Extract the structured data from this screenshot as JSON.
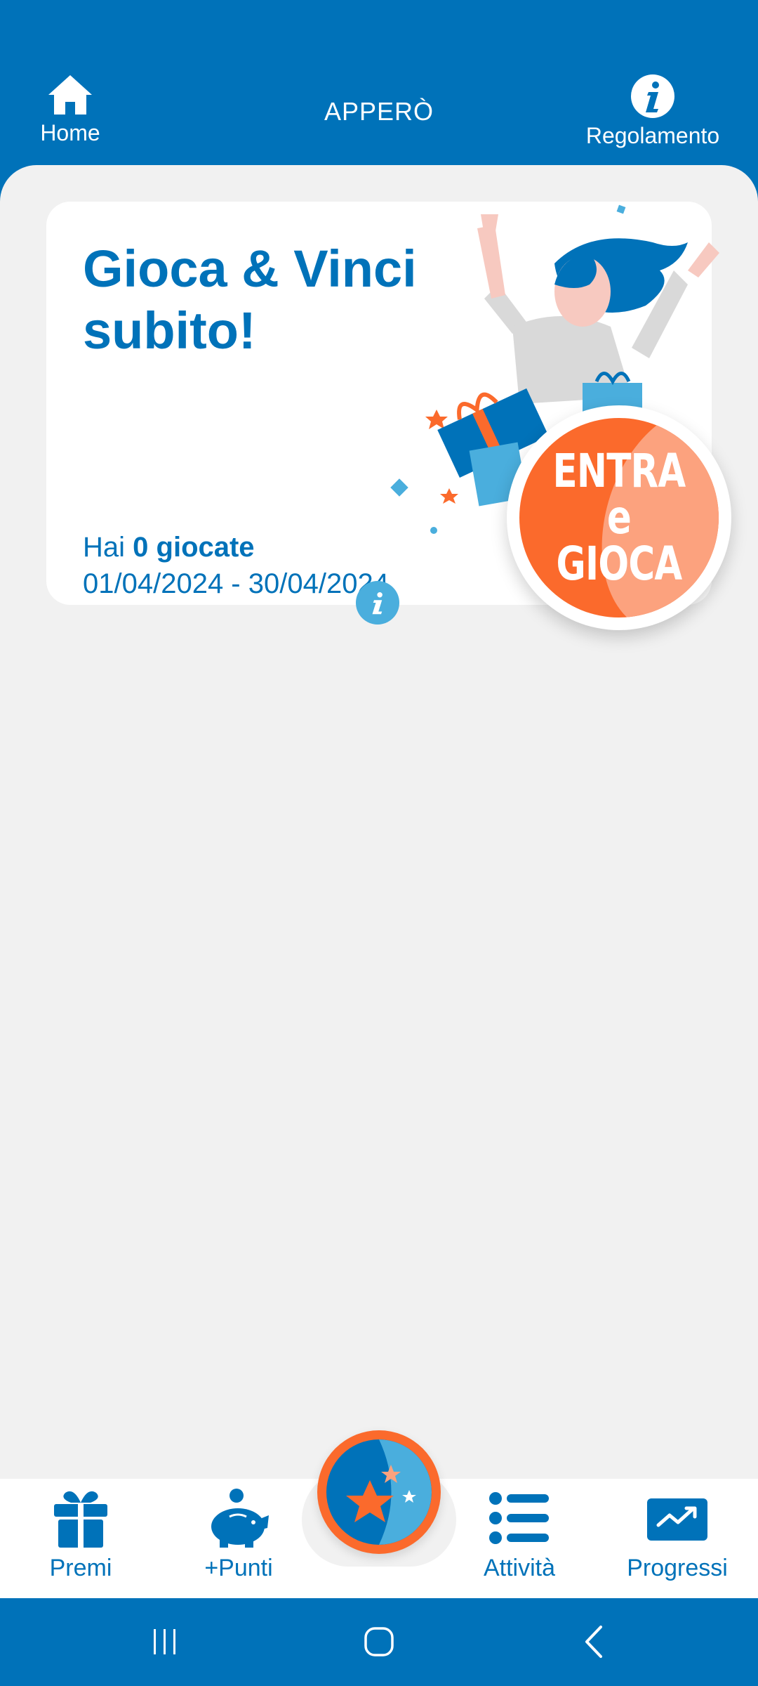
{
  "header": {
    "title": "APPERÒ",
    "home_label": "Home",
    "rules_label": "Regolamento",
    "home_icon": "home-icon",
    "rules_icon": "info-icon"
  },
  "card": {
    "title": "Gioca & Vinci subito!",
    "plays_prefix": "Hai",
    "plays_count": "0 giocate",
    "dates": "01/04/2024 - 30/04/2024",
    "play_button_line1": "ENTRA e",
    "play_button_line2": "GIOCA",
    "info_icon": "info-icon"
  },
  "bottom_nav": {
    "items": [
      {
        "label": "Premi",
        "icon": "gift-icon"
      },
      {
        "label": "+Punti",
        "icon": "piggy-bank-icon"
      },
      {
        "label": "Attività",
        "icon": "list-icon"
      },
      {
        "label": "Progressi",
        "icon": "chart-trend-icon"
      }
    ],
    "center_icon": "stars-icon"
  },
  "colors": {
    "primary": "#0072b9",
    "accent": "#fb6a2c",
    "light_blue": "#4aaedd",
    "background": "#f1f1f1"
  }
}
